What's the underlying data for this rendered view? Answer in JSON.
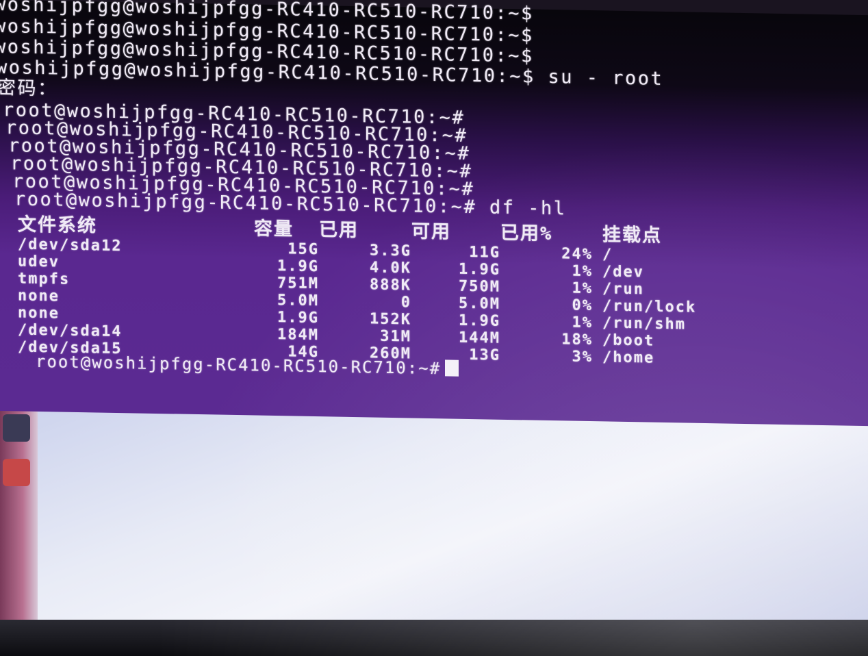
{
  "terminal": {
    "prompt_lines": [
      "woshijpfgg@woshijpfgg-RC410-RC510-RC710:~$",
      "woshijpfgg@woshijpfgg-RC410-RC510-RC710:~$",
      "woshijpfgg@woshijpfgg-RC410-RC510-RC710:~$",
      "woshijpfgg@woshijpfgg-RC410-RC510-RC710:~$ su - root"
    ],
    "password_prompt": "密码：",
    "root_lines": [
      "root@woshijpfgg-RC410-RC510-RC710:~#",
      "root@woshijpfgg-RC410-RC510-RC710:~#",
      "root@woshijpfgg-RC410-RC510-RC710:~#",
      "root@woshijpfgg-RC410-RC510-RC710:~#",
      "root@woshijpfgg-RC410-RC510-RC710:~#",
      "root@woshijpfgg-RC410-RC510-RC710:~# df -hl"
    ],
    "df": {
      "headers": [
        "文件系统",
        "容量",
        "已用",
        "可用",
        "已用%",
        "挂载点"
      ],
      "rows": [
        [
          "/dev/sda12",
          "15G",
          "3.3G",
          "11G",
          "24%",
          "/"
        ],
        [
          "udev",
          "1.9G",
          "4.0K",
          "1.9G",
          "1%",
          "/dev"
        ],
        [
          "tmpfs",
          "751M",
          "888K",
          "750M",
          "1%",
          "/run"
        ],
        [
          "none",
          "5.0M",
          "0",
          "5.0M",
          "0%",
          "/run/lock"
        ],
        [
          "none",
          "1.9G",
          "152K",
          "1.9G",
          "1%",
          "/run/shm"
        ],
        [
          "/dev/sda14",
          "184M",
          "31M",
          "144M",
          "18%",
          "/boot"
        ],
        [
          "/dev/sda15",
          "14G",
          "260M",
          "13G",
          "3%",
          "/home"
        ]
      ]
    },
    "final_prompt": "root@woshijpfgg-RC410-RC510-RC710:~#"
  },
  "colors": {
    "terminal_text": "#f0eaf6",
    "terminal_bg_top": "#08060c",
    "terminal_bg_bottom": "#5b2a92"
  },
  "icons": [
    "terminal-cursor-icon",
    "launcher-app-icon"
  ]
}
